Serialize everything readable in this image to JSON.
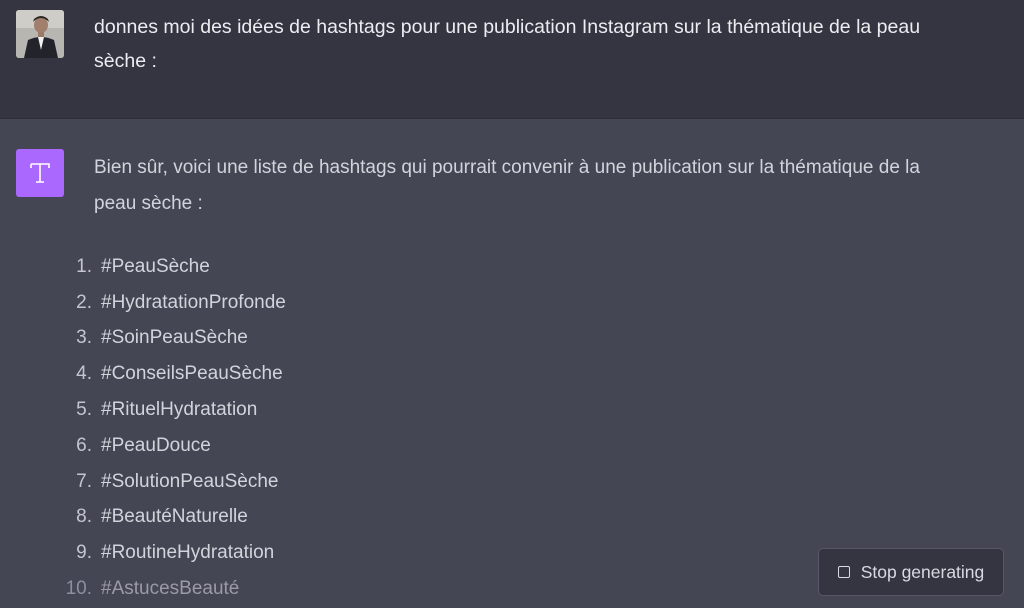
{
  "user_message": {
    "text": "donnes moi des idées de hashtags pour une publication Instagram sur la thématique de la peau sèche :"
  },
  "assistant_message": {
    "avatar_letter": "T",
    "intro": "Bien sûr, voici une liste de hashtags qui pourrait convenir à une publication sur la thématique de la peau sèche :",
    "items": [
      {
        "num": "1.",
        "text": "#PeauSèche"
      },
      {
        "num": "2.",
        "text": "#HydratationProfonde"
      },
      {
        "num": "3.",
        "text": "#SoinPeauSèche"
      },
      {
        "num": "4.",
        "text": "#ConseilsPeauSèche"
      },
      {
        "num": "5.",
        "text": "#RituelHydratation"
      },
      {
        "num": "6.",
        "text": "#PeauDouce"
      },
      {
        "num": "7.",
        "text": "#SolutionPeauSèche"
      },
      {
        "num": "8.",
        "text": "#BeautéNaturelle"
      },
      {
        "num": "9.",
        "text": "#RoutineHydratation"
      },
      {
        "num": "10.",
        "text": "#AstucesBeauté"
      }
    ]
  },
  "stop_button": {
    "label": "Stop generating",
    "icon": "stop-square-icon"
  },
  "colors": {
    "user_bg": "#343541",
    "assistant_bg": "#444654",
    "assistant_avatar_bg": "#ab68ff",
    "text": "#d1d5db"
  }
}
